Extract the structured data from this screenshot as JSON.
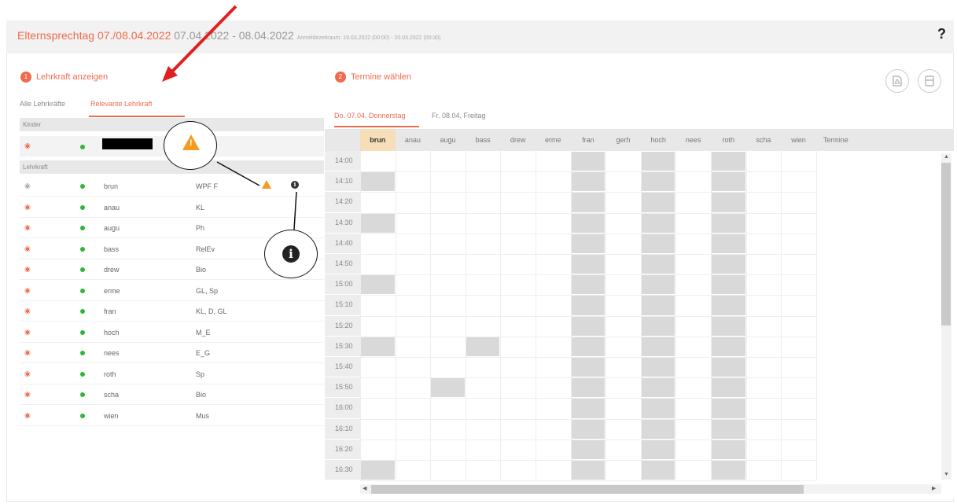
{
  "header": {
    "title_event": "Elternsprechtag 07./08.04.2022",
    "title_dates": "07.04.2022 - 08.04.2022",
    "title_period": "Anmeldezeitraum: 19.03.2022 (00:00) - 20.03.2022 (00:30)",
    "help": "?"
  },
  "step1": {
    "num": "1",
    "label": "Lehrkraft anzeigen"
  },
  "step2": {
    "num": "2",
    "label": "Termine wählen"
  },
  "left_tabs": {
    "all": "Alle Lehrkräfte",
    "relevant": "Relevante Lehrkraft"
  },
  "sections": {
    "kinder": "Kinder",
    "lehrkraft": "Lehrkraft"
  },
  "teachers": [
    {
      "name": "brun",
      "subject": "WPF F"
    },
    {
      "name": "anau",
      "subject": "KL"
    },
    {
      "name": "augu",
      "subject": "Ph"
    },
    {
      "name": "bass",
      "subject": "RelEv"
    },
    {
      "name": "drew",
      "subject": "Bio"
    },
    {
      "name": "erme",
      "subject": "GL, Sp"
    },
    {
      "name": "fran",
      "subject": "KL, D, GL"
    },
    {
      "name": "hoch",
      "subject": "M_E"
    },
    {
      "name": "nees",
      "subject": "E_G"
    },
    {
      "name": "roth",
      "subject": "Sp"
    },
    {
      "name": "scha",
      "subject": "Bio"
    },
    {
      "name": "wien",
      "subject": "Mus"
    }
  ],
  "day_tabs": {
    "thu": "Do. 07.04. Donnerstag",
    "fri": "Fr. 08.04. Freitag"
  },
  "columns": [
    "brun",
    "anau",
    "augu",
    "bass",
    "drew",
    "erme",
    "fran",
    "gerh",
    "hoch",
    "nees",
    "roth",
    "scha",
    "wien"
  ],
  "termine": "Termine",
  "times": [
    "14:00",
    "14:10",
    "14:20",
    "14:30",
    "14:40",
    "14:50",
    "15:00",
    "15:10",
    "15:20",
    "15:30",
    "15:40",
    "15:50",
    "16:00",
    "16:10",
    "16:20",
    "16:30"
  ],
  "icons": {
    "eye": "eye-icon",
    "status_dot": "status-dot",
    "warning": "warning-icon",
    "info": "info-icon",
    "pdf": "pdf-icon",
    "print": "print-icon"
  },
  "colors": {
    "accent": "#ef6b4b",
    "status_green": "#2fb53a",
    "warning_orange": "#f39c1f",
    "selected_column": "#f5deb8",
    "blocked_slot": "#d9d9d9"
  }
}
